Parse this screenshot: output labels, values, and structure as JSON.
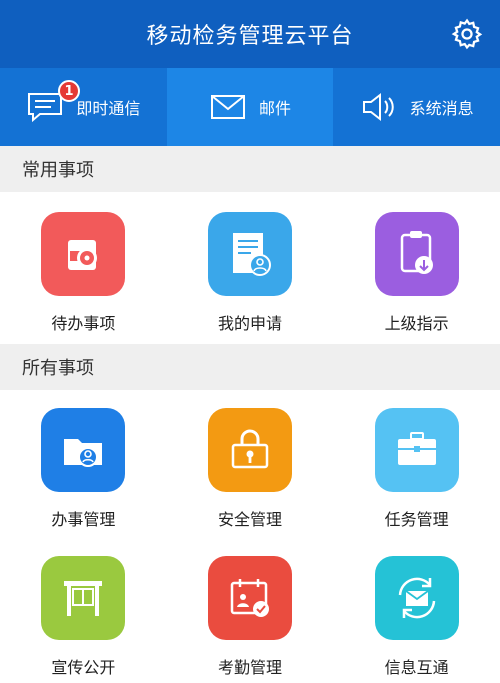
{
  "header": {
    "title": "移动检务管理云平台",
    "settings_icon": "gear-icon"
  },
  "tabs": [
    {
      "label": "即时通信",
      "icon": "chat-icon",
      "badge": "1"
    },
    {
      "label": "邮件",
      "icon": "mail-icon"
    },
    {
      "label": "系统消息",
      "icon": "speaker-icon"
    }
  ],
  "common": {
    "title": "常用事项",
    "items": [
      {
        "label": "待办事项",
        "icon": "disc-folder-icon",
        "color": "#f25a5a"
      },
      {
        "label": "我的申请",
        "icon": "document-user-icon",
        "color": "#3aa7ea"
      },
      {
        "label": "上级指示",
        "icon": "clipboard-download-icon",
        "color": "#9b5ee0"
      }
    ]
  },
  "all": {
    "title": "所有事项",
    "items": [
      {
        "label": "办事管理",
        "icon": "folder-user-icon",
        "color": "#1f7fe6"
      },
      {
        "label": "安全管理",
        "icon": "lock-icon",
        "color": "#f39a12"
      },
      {
        "label": "任务管理",
        "icon": "briefcase-icon",
        "color": "#55c2f3"
      },
      {
        "label": "宣传公开",
        "icon": "bulletin-board-icon",
        "color": "#9ac93f"
      },
      {
        "label": "考勤管理",
        "icon": "calendar-check-icon",
        "color": "#ea4c3f"
      },
      {
        "label": "信息互通",
        "icon": "mail-sync-icon",
        "color": "#25c2d6"
      }
    ]
  }
}
